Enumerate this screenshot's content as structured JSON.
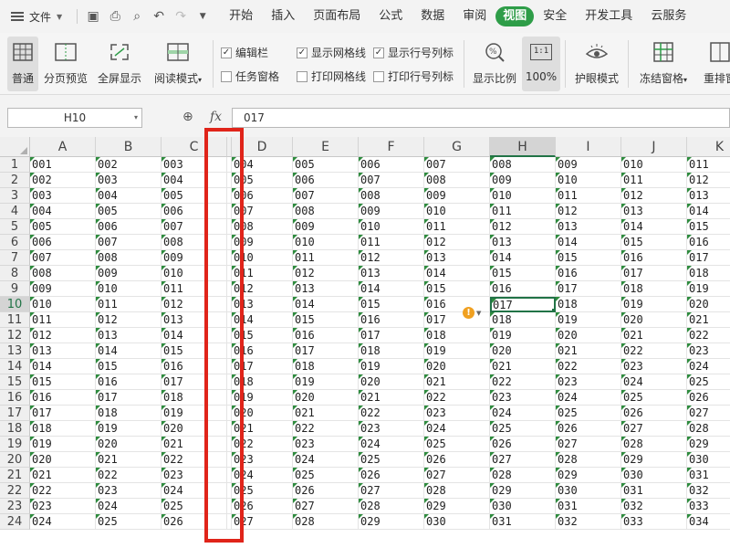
{
  "menu": {
    "file_label": "文件",
    "tabs": [
      "开始",
      "插入",
      "页面布局",
      "公式",
      "数据",
      "审阅",
      "视图",
      "安全",
      "开发工具",
      "云服务"
    ],
    "active_tab_index": 6
  },
  "ribbon": {
    "normal": "普通",
    "page_break": "分页预览",
    "fullscreen": "全屏显示",
    "reading_mode": "阅读模式",
    "edit_bar": {
      "label": "编辑栏",
      "checked": true
    },
    "task_pane": {
      "label": "任务窗格",
      "checked": false
    },
    "show_gridlines": {
      "label": "显示网格线",
      "checked": true
    },
    "print_gridlines": {
      "label": "打印网格线",
      "checked": false
    },
    "show_headers": {
      "label": "显示行号列标",
      "checked": true
    },
    "print_headers": {
      "label": "打印行号列标",
      "checked": false
    },
    "zoom_ratio": "显示比例",
    "zoom_100_icon": "1:1",
    "zoom_100": "100%",
    "eye_mode": "护眼模式",
    "freeze_panes": "冻结窗格",
    "rearrange": "重排窗"
  },
  "formula_bar": {
    "name_box": "H10",
    "fx": "fx",
    "value": "017"
  },
  "grid": {
    "columns": [
      "A",
      "B",
      "C",
      "",
      "D",
      "E",
      "F",
      "G",
      "H",
      "I",
      "J",
      "K"
    ],
    "selected_column": "H",
    "selected_row": 10,
    "first_row": 1,
    "row_count": 24,
    "cells": [
      [
        "001",
        "002",
        "003",
        "",
        "004",
        "005",
        "006",
        "007",
        "008",
        "009",
        "010",
        "011"
      ],
      [
        "002",
        "003",
        "004",
        "",
        "005",
        "006",
        "007",
        "008",
        "009",
        "010",
        "011",
        "012"
      ],
      [
        "003",
        "004",
        "005",
        "",
        "006",
        "007",
        "008",
        "009",
        "010",
        "011",
        "012",
        "013"
      ],
      [
        "004",
        "005",
        "006",
        "",
        "007",
        "008",
        "009",
        "010",
        "011",
        "012",
        "013",
        "014"
      ],
      [
        "005",
        "006",
        "007",
        "",
        "008",
        "009",
        "010",
        "011",
        "012",
        "013",
        "014",
        "015"
      ],
      [
        "006",
        "007",
        "008",
        "",
        "009",
        "010",
        "011",
        "012",
        "013",
        "014",
        "015",
        "016"
      ],
      [
        "007",
        "008",
        "009",
        "",
        "010",
        "011",
        "012",
        "013",
        "014",
        "015",
        "016",
        "017"
      ],
      [
        "008",
        "009",
        "010",
        "",
        "011",
        "012",
        "013",
        "014",
        "015",
        "016",
        "017",
        "018"
      ],
      [
        "009",
        "010",
        "011",
        "",
        "012",
        "013",
        "014",
        "015",
        "016",
        "017",
        "018",
        "019"
      ],
      [
        "010",
        "011",
        "012",
        "",
        "013",
        "014",
        "015",
        "016",
        "017",
        "018",
        "019",
        "020"
      ],
      [
        "011",
        "012",
        "013",
        "",
        "014",
        "015",
        "016",
        "017",
        "018",
        "019",
        "020",
        "021"
      ],
      [
        "012",
        "013",
        "014",
        "",
        "015",
        "016",
        "017",
        "018",
        "019",
        "020",
        "021",
        "022"
      ],
      [
        "013",
        "014",
        "015",
        "",
        "016",
        "017",
        "018",
        "019",
        "020",
        "021",
        "022",
        "023"
      ],
      [
        "014",
        "015",
        "016",
        "",
        "017",
        "018",
        "019",
        "020",
        "021",
        "022",
        "023",
        "024"
      ],
      [
        "015",
        "016",
        "017",
        "",
        "018",
        "019",
        "020",
        "021",
        "022",
        "023",
        "024",
        "025"
      ],
      [
        "016",
        "017",
        "018",
        "",
        "019",
        "020",
        "021",
        "022",
        "023",
        "024",
        "025",
        "026"
      ],
      [
        "017",
        "018",
        "019",
        "",
        "020",
        "021",
        "022",
        "023",
        "024",
        "025",
        "026",
        "027"
      ],
      [
        "018",
        "019",
        "020",
        "",
        "021",
        "022",
        "023",
        "024",
        "025",
        "026",
        "027",
        "028"
      ],
      [
        "019",
        "020",
        "021",
        "",
        "022",
        "023",
        "024",
        "025",
        "026",
        "027",
        "028",
        "029"
      ],
      [
        "020",
        "021",
        "022",
        "",
        "023",
        "024",
        "025",
        "026",
        "027",
        "028",
        "029",
        "030"
      ],
      [
        "021",
        "022",
        "023",
        "",
        "024",
        "025",
        "026",
        "027",
        "028",
        "029",
        "030",
        "031"
      ],
      [
        "022",
        "023",
        "024",
        "",
        "025",
        "026",
        "027",
        "028",
        "029",
        "030",
        "031",
        "032"
      ],
      [
        "023",
        "024",
        "025",
        "",
        "026",
        "027",
        "028",
        "029",
        "030",
        "031",
        "032",
        "033"
      ],
      [
        "024",
        "025",
        "026",
        "",
        "027",
        "028",
        "029",
        "030",
        "031",
        "032",
        "033",
        "034"
      ]
    ]
  },
  "colors": {
    "accent": "#2e9d48",
    "selection": "#217346",
    "highlight_box": "#e0241a",
    "number_as_text_flag": "#2e8b3e"
  }
}
